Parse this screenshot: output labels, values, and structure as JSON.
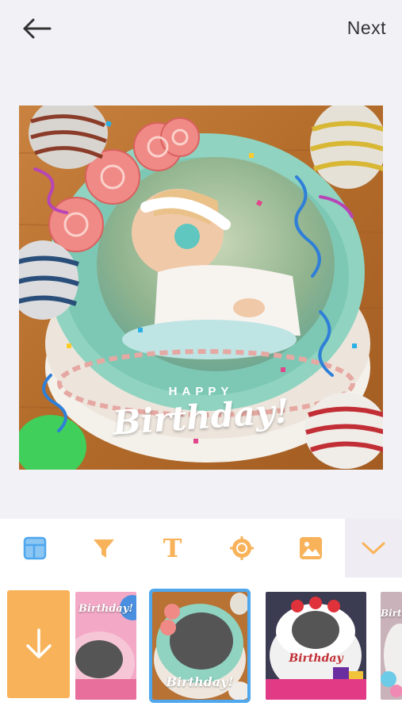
{
  "header": {
    "back_icon": "arrow-left-icon",
    "next_label": "Next"
  },
  "canvas": {
    "greeting_small": "HAPPY",
    "greeting_large": "Birthday!"
  },
  "toolbar": {
    "tools": [
      {
        "id": "layout",
        "icon": "layout-icon",
        "active": true
      },
      {
        "id": "filter",
        "icon": "filter-icon",
        "active": false
      },
      {
        "id": "text",
        "icon": "text-icon",
        "label": "T",
        "active": false
      },
      {
        "id": "sticker",
        "icon": "sticker-icon",
        "active": false
      },
      {
        "id": "image",
        "icon": "image-icon",
        "active": false
      }
    ],
    "collapse_icon": "chevron-down-icon",
    "accent_color": "#f8b35a",
    "active_color": "#4fa7ee"
  },
  "templates": {
    "download_icon": "arrow-down-icon",
    "items": [
      {
        "label": "Birthday!",
        "selected": false
      },
      {
        "label": "Birthday!",
        "selected": true
      },
      {
        "label": "Birthday",
        "selected": false
      },
      {
        "label": "Birthday",
        "selected": false
      }
    ]
  }
}
